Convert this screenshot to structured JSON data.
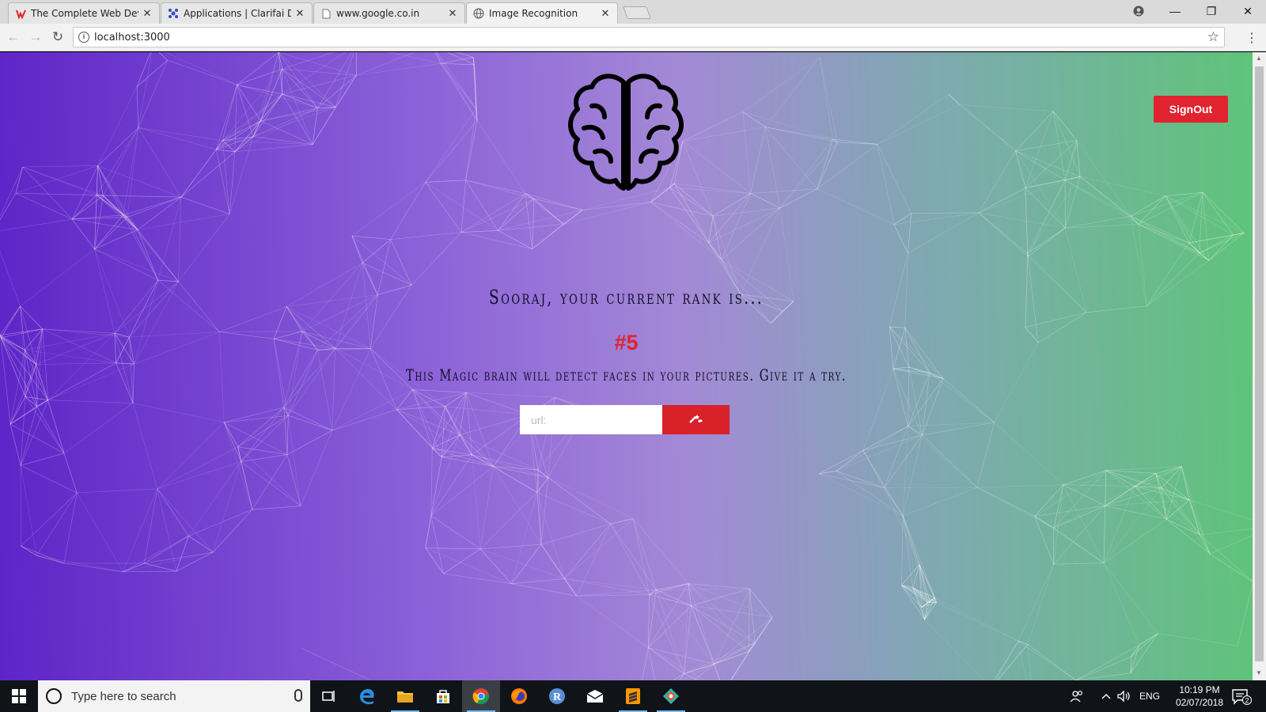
{
  "browser": {
    "tabs": [
      {
        "title": "The Complete Web Deve",
        "favicon": "udemy-icon",
        "active": false
      },
      {
        "title": "Applications | Clarifai De",
        "favicon": "clarifai-icon",
        "active": false
      },
      {
        "title": "www.google.co.in",
        "favicon": "page-icon",
        "active": false
      },
      {
        "title": "Image Recognition",
        "favicon": "globe-icon",
        "active": true
      }
    ],
    "url": "localhost:3000"
  },
  "page": {
    "signout_label": "SignOut",
    "rank_line": "Sooraj, your current rank is...",
    "rank_value": "#5",
    "tagline": "This Magic brain will detect faces in your pictures. Give it a try.",
    "input_placeholder": "url:",
    "detect_button_icon": "magic-wand-icon",
    "colors": {
      "gradient_start": "#5d24c7",
      "gradient_end": "#5fc47a",
      "accent_red": "#e0232e",
      "text_dark": "#101028"
    }
  },
  "taskbar": {
    "search_placeholder": "Type here to search",
    "language": "ENG",
    "time": "10:19 PM",
    "date": "02/07/2018",
    "notification_count": "2"
  }
}
